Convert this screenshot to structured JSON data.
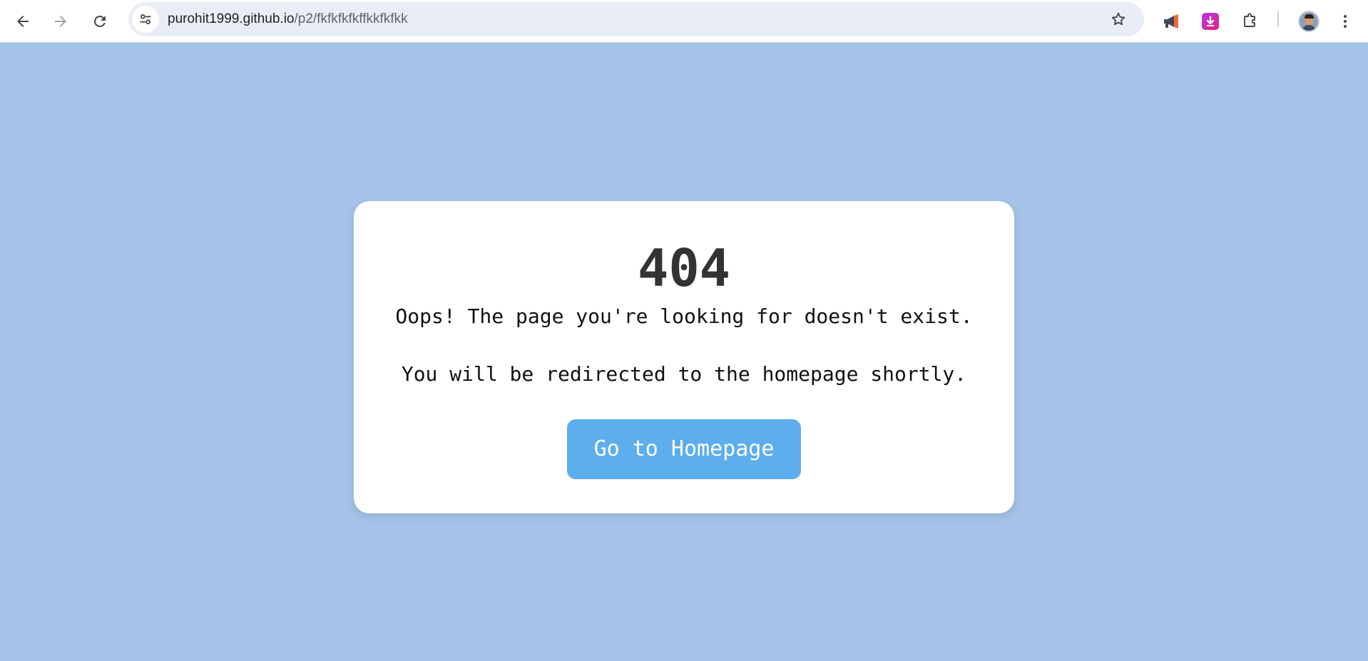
{
  "browser": {
    "url_host": "purohit1999.github.io",
    "url_path": "/p2/fkfkfkfkffkkfkfkk",
    "icons": {
      "back": "arrow-left-icon",
      "forward": "arrow-right-icon",
      "reload": "reload-icon",
      "site_info": "tune-icon",
      "bookmark": "star-icon",
      "extension_1": "megaphone-icon",
      "extension_2": "download-icon",
      "extensions": "puzzle-icon",
      "profile": "avatar",
      "menu": "kebab-menu-icon"
    }
  },
  "page": {
    "background_color": "#a5c3e8",
    "card": {
      "code": "404",
      "message": "Oops! The page you're looking for doesn't exist.",
      "redirect_note": "You will be redirected to the homepage shortly.",
      "button_label": "Go to Homepage",
      "button_color": "#5daeed"
    }
  }
}
